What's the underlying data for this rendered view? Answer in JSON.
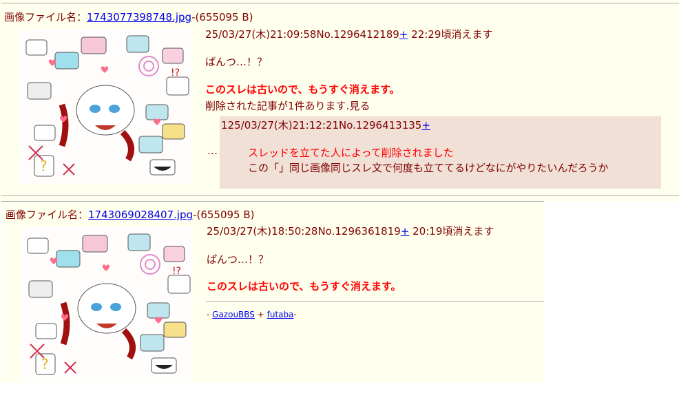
{
  "threads": [
    {
      "file_label": "画像ファイル名：",
      "file_name": "1743077398748.jpg",
      "file_size": "-(655095 B)",
      "datetime": "25/03/27(木)21:09:58",
      "post_no": "No.1296412189",
      "plus": "+",
      "expire": "22:29頃消えます",
      "body": "ぱんつ…！？",
      "warning": "このスレは古いので、もうすぐ消えます。",
      "deleted_notice": "削除された記事が1件あります.見る",
      "reply": {
        "marker": "…",
        "number": "1",
        "datetime": "25/03/27(木)21:12:21",
        "post_no": "No.1296413135",
        "plus": "+",
        "deleted_by_op": "スレッドを立てた人によって削除されました",
        "text": "この「」同じ画像同じスレ文で何度も立ててるけどなにがやりたいんだろうか"
      }
    },
    {
      "file_label": "画像ファイル名：",
      "file_name": "1743069028407.jpg",
      "file_size": "-(655095 B)",
      "datetime": "25/03/27(木)18:50:28",
      "post_no": "No.1296361819",
      "plus": "+",
      "expire": "20:19頃消えます",
      "body": "ぱんつ…！？",
      "warning": "このスレは古いので、もうすぐ消えます。"
    }
  ],
  "footer": {
    "prefix": "- ",
    "link1": "GazouBBS",
    "sep": " + ",
    "link2": "futaba",
    "suffix": "-"
  },
  "colors": {
    "background": "#ffffee",
    "text": "#800000",
    "warning": "#ff0000",
    "link": "#0000ee",
    "reply_bg": "#f0e0d6"
  }
}
